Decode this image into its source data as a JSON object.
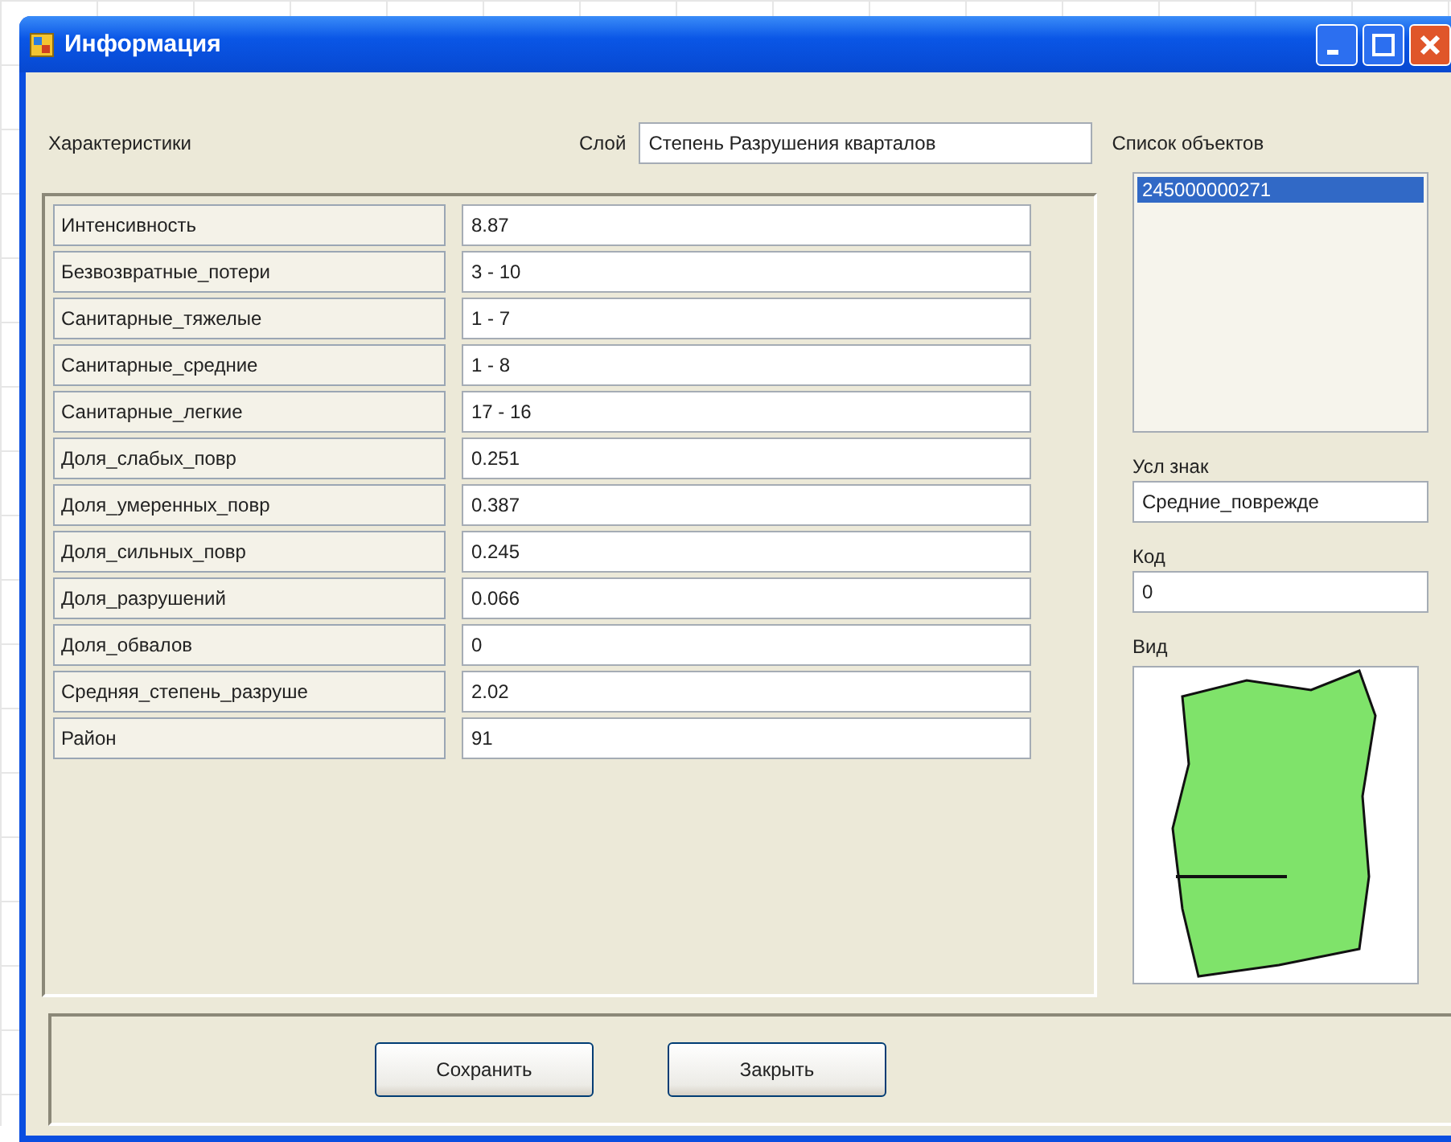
{
  "window": {
    "title": "Информация"
  },
  "characteristics_label": "Характеристики",
  "layer": {
    "label": "Слой",
    "value": "Степень Разрушения кварталов"
  },
  "object_list": {
    "label": "Список объектов",
    "items": [
      {
        "text": "245000000271",
        "selected": true
      }
    ]
  },
  "properties": [
    {
      "name": "Интенсивность",
      "value": "8.87"
    },
    {
      "name": "Безвозвратные_потери",
      "value": "3 - 10"
    },
    {
      "name": "Санитарные_тяжелые",
      "value": "1 - 7"
    },
    {
      "name": "Санитарные_средние",
      "value": "1 - 8"
    },
    {
      "name": "Санитарные_легкие",
      "value": "17 - 16"
    },
    {
      "name": "Доля_слабых_повр",
      "value": "0.251"
    },
    {
      "name": "Доля_умеренных_повр",
      "value": "0.387"
    },
    {
      "name": "Доля_сильных_повр",
      "value": "0.245"
    },
    {
      "name": "Доля_разрушений",
      "value": "0.066"
    },
    {
      "name": "Доля_обвалов",
      "value": "0"
    },
    {
      "name": "Средняя_степень_разруше",
      "value": "2.02"
    },
    {
      "name": "Район",
      "value": "91"
    }
  ],
  "symbol": {
    "label": "Усл знак",
    "value": "Средние_поврежде"
  },
  "code": {
    "label": "Код",
    "value": "0"
  },
  "view": {
    "label": "Вид"
  },
  "buttons": [
    "Сохранить",
    "Закрыть"
  ]
}
